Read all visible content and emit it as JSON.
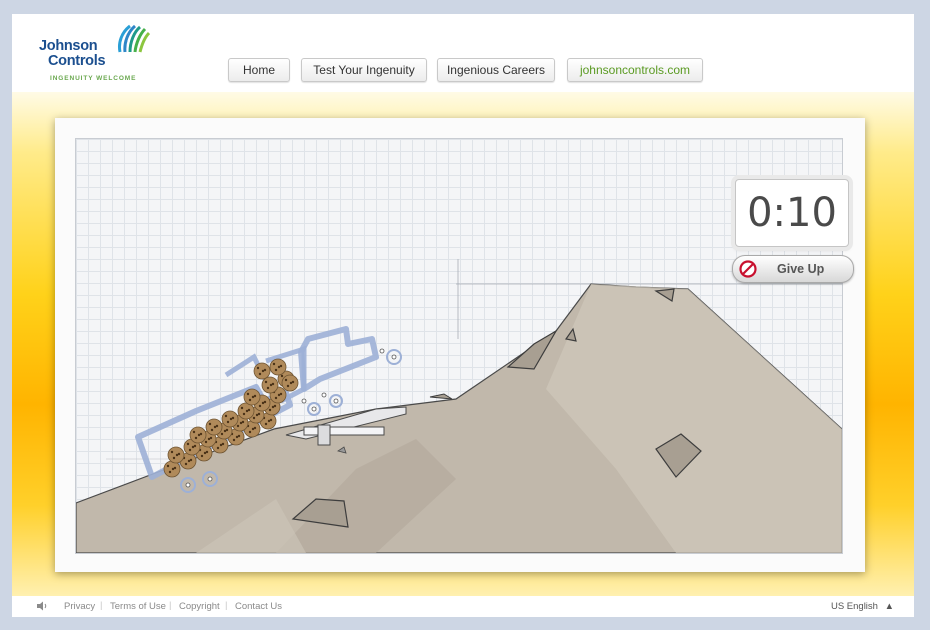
{
  "logo": {
    "line1": "Johnson",
    "line2": "Controls",
    "tagline": "INGENUITY WELCOME",
    "icon": "jci-swoosh-icon",
    "brand_blue": "#1b4f8f",
    "brand_green": "#6aa84f"
  },
  "nav": {
    "items": [
      {
        "label": "Home"
      },
      {
        "label": "Test Your Ingenuity"
      },
      {
        "label": "Ingenious Careers"
      },
      {
        "label": "johnsoncontrols.com"
      }
    ]
  },
  "game": {
    "timer": "0:10",
    "give_up_label": "Give Up",
    "give_up_icon": "no-entry-icon",
    "terrain_color": "#c1b8ab",
    "vehicle_color": "#9db0d6"
  },
  "footer": {
    "speaker_icon": "speaker-icon",
    "links": [
      {
        "label": "Privacy"
      },
      {
        "label": "Terms of Use"
      },
      {
        "label": "Copyright"
      },
      {
        "label": "Contact Us"
      }
    ],
    "language": "US English",
    "language_icon": "caret-up-icon"
  }
}
